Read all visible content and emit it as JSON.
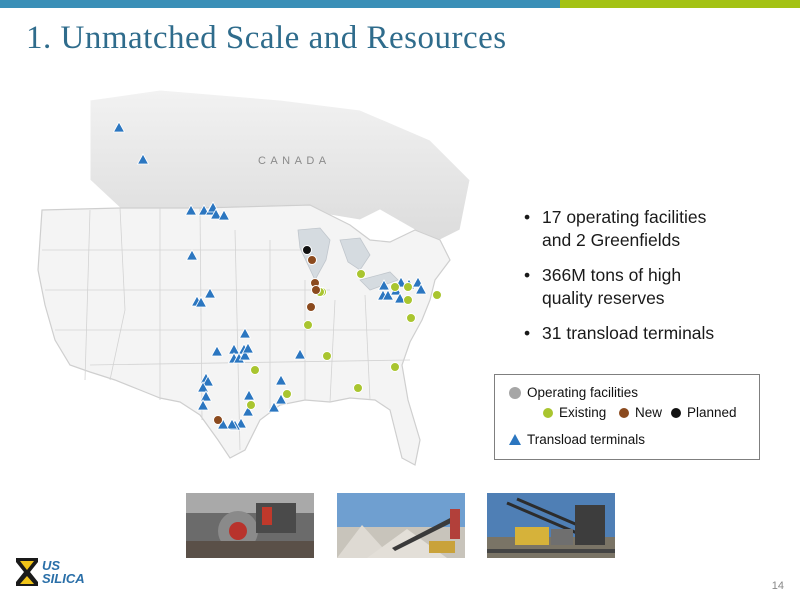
{
  "slide": {
    "title": "1. Unmatched Scale and Resources",
    "page_number": "14"
  },
  "map": {
    "country_label": "C A N A D A"
  },
  "bullets": [
    {
      "line1": "17 operating facilities",
      "line2": "and 2 Greenfields"
    },
    {
      "line1": "366M tons of high",
      "line2": "quality reserves"
    },
    {
      "line1": "31 transload terminals",
      "line2": ""
    }
  ],
  "legend": {
    "operating_label": "Operating facilities",
    "existing_label": "Existing",
    "new_label": "New",
    "planned_label": "Planned",
    "transload_label": "Transload terminals"
  },
  "logo": {
    "line1": "US",
    "line2": "SILICA"
  },
  "colors": {
    "existing": "#a9c52f",
    "new": "#8b4a1e",
    "planned": "#111111",
    "transload": "#2b76c0",
    "operating": "#a6a6a6",
    "title": "#2f6c8c"
  }
}
